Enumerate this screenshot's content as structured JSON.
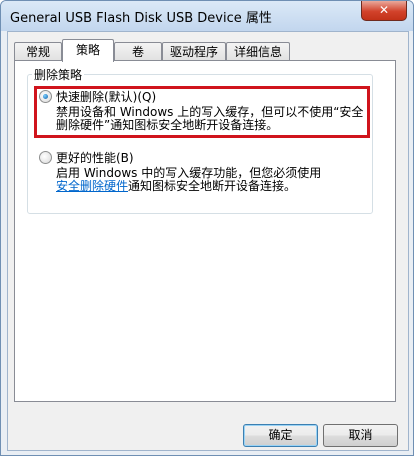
{
  "window": {
    "title": "General USB Flash Disk USB Device 属性",
    "close_label": "✕"
  },
  "tabs": [
    {
      "label": "常规"
    },
    {
      "label": "策略"
    },
    {
      "label": "卷"
    },
    {
      "label": "驱动程序"
    },
    {
      "label": "详细信息"
    }
  ],
  "active_tab": "策略",
  "group": {
    "legend": "删除策略"
  },
  "options": {
    "quick": {
      "label": "快速删除(默认)(Q)",
      "desc_line1": "禁用设备和 Windows 上的写入缓存，但可以不使用“安全",
      "desc_line2": "删除硬件”通知图标安全地断开设备连接。",
      "checked": true
    },
    "better": {
      "label": "更好的性能(B)",
      "desc_line1": "启用 Windows 中的写入缓存功能，但您必须使用",
      "link_text": "安全删除硬件",
      "desc_line2_rest": "通知图标安全地断开设备连接。",
      "checked": false
    }
  },
  "buttons": {
    "ok": "确定",
    "cancel": "取消"
  },
  "colors": {
    "highlight_border": "#d0141c",
    "link": "#0066cc"
  }
}
